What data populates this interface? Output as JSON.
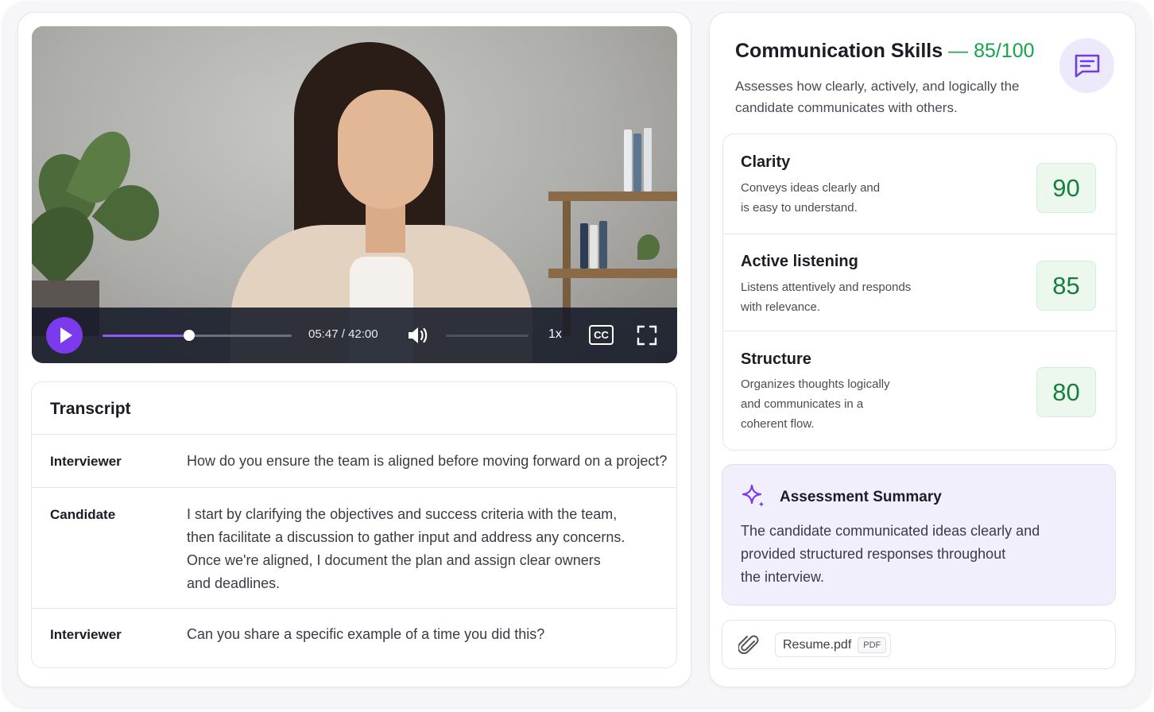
{
  "video": {
    "current_time": "05:47",
    "separator": "/",
    "duration": "42:00",
    "progress": 0.457,
    "volume": 0.0,
    "speed": "1x",
    "cc_label": "CC"
  },
  "transcript": {
    "title": "Transcript",
    "rows": [
      {
        "speaker": "Interviewer",
        "lines": [
          "How do you ensure the team is aligned before moving forward on a project?"
        ]
      },
      {
        "speaker": "Candidate",
        "lines": [
          "I start by clarifying the objectives and success criteria with the team,",
          "then facilitate a discussion to gather input and address any concerns.",
          "Once we're aligned, I document the plan and assign clear owners",
          "and deadlines."
        ]
      },
      {
        "speaker": "Interviewer",
        "lines": [
          "Can you share a specific example of a time you did this?"
        ]
      }
    ]
  },
  "skill": {
    "title": "Communication Skills",
    "score_text": "— 85/100",
    "description": [
      "Assesses how clearly, actively, and logically the",
      "candidate communicates with others."
    ],
    "icon": "chat-icon"
  },
  "metrics": [
    {
      "name": "Clarity",
      "lines": [
        "Conveys ideas clearly and",
        "is easy to understand."
      ],
      "score": "90"
    },
    {
      "name": "Active listening",
      "lines": [
        "Listens attentively and responds",
        "with relevance."
      ],
      "score": "85"
    },
    {
      "name": "Structure",
      "lines": [
        "Organizes thoughts logically",
        "and communicates in a",
        "coherent flow."
      ],
      "score": "80"
    }
  ],
  "summary": {
    "title": "Assessment Summary",
    "icon": "sparkle-icon",
    "lines": [
      "The candidate communicated ideas clearly and",
      "provided structured responses throughout",
      "the interview."
    ]
  },
  "attachment": {
    "icon": "paperclip-icon",
    "file_name": "Resume.pdf",
    "file_type": "PDF"
  },
  "colors": {
    "accent": "#7c3aed",
    "score_green": "#16a34a",
    "summary_bg": "#f1effc"
  }
}
